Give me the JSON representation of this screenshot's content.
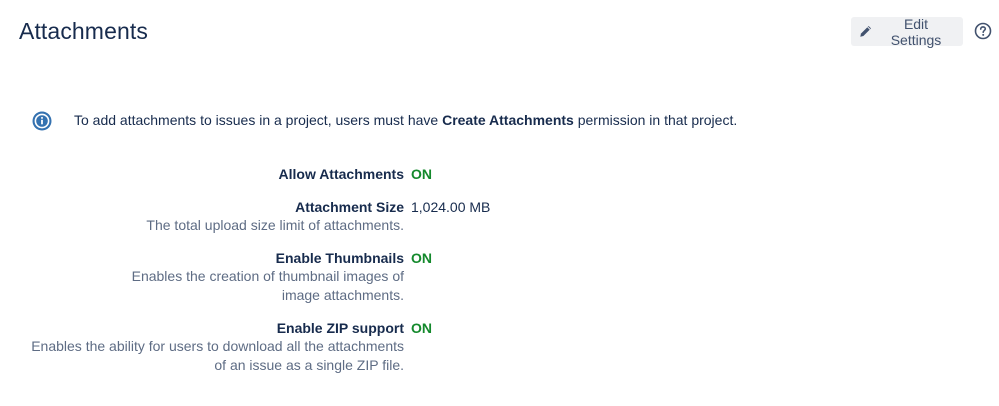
{
  "header": {
    "title": "Attachments",
    "edit_label": "Edit Settings",
    "edit_icon": "pencil-icon",
    "help_icon": "help-icon"
  },
  "info": {
    "icon": "info-icon",
    "text_before": "To add attachments to issues in a project, users must have ",
    "text_bold": "Create Attachments",
    "text_after": " permission in that project."
  },
  "settings": [
    {
      "label": "Allow Attachments",
      "value": "ON",
      "description": ""
    },
    {
      "label": "Attachment Size",
      "value": "1,024.00 MB",
      "description": "The total upload size limit of attachments."
    },
    {
      "label": "Enable Thumbnails",
      "value": "ON",
      "description": "Enables the creation of thumbnail images of image attachments."
    },
    {
      "label": "Enable ZIP support",
      "value": "ON",
      "description": "Enables the ability for users to download all the attachments of an issue as a single ZIP file."
    }
  ],
  "colors": {
    "title": "#172b4d",
    "on_value": "#14892c",
    "info_icon": "#3572b0",
    "button_bg": "#f0f1f3",
    "description": "#5e6c84"
  }
}
